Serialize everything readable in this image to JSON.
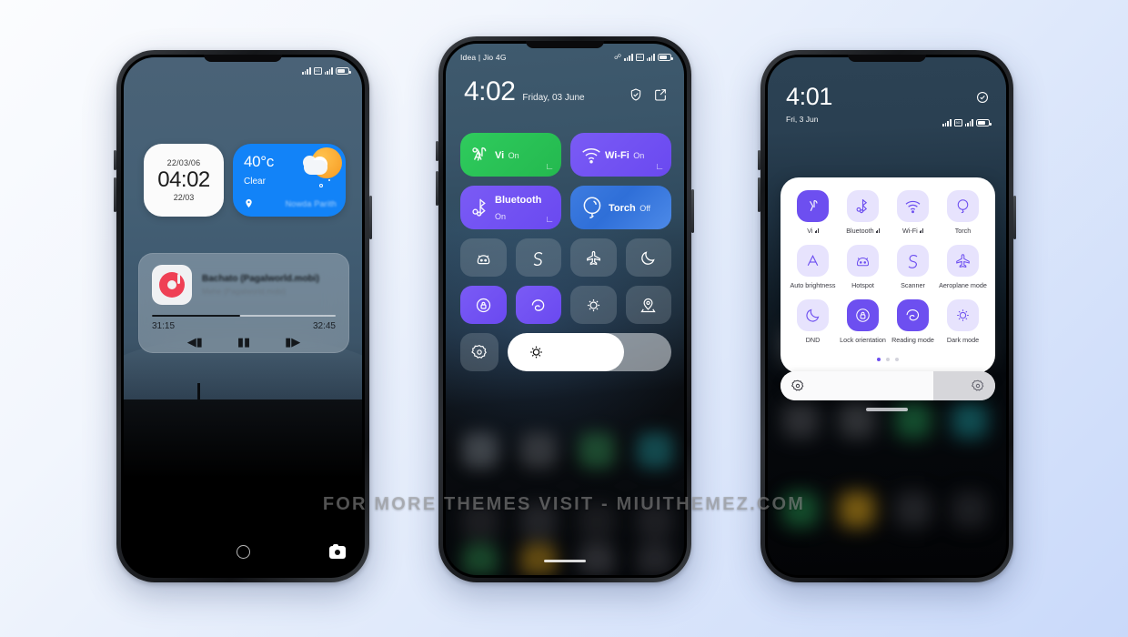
{
  "watermark": "FOR MORE THEMES VISIT - MIUITHEMEZ.COM",
  "colors": {
    "accent_purple": "#6d4ff0",
    "accent_purple_light": "#e7e3fd",
    "tile_green": "#2fcb5d",
    "tile_blue": "#3e7ce0",
    "weather_blue": "#1283f8",
    "page_bg_start": "#fbfcfe",
    "page_bg_end": "#c9d9fa"
  },
  "lockscreen": {
    "statusbar": {
      "carrier": "",
      "icons": [
        "signal-bars-icon",
        "sim-card-icon",
        "signal-bars-icon",
        "battery-icon"
      ]
    },
    "clock_widget": {
      "date_top": "22/03/06",
      "time": "04:02",
      "date_bottom": "22/03"
    },
    "weather_widget": {
      "temperature": "40°c",
      "condition": "Clear",
      "location": "Nowda Parith",
      "icon": "partly-cloudy-icon"
    },
    "music_player": {
      "title": "Bachato (Pagalworld.mobi)",
      "artist": "Mehe (Pagalworld.mobi)",
      "elapsed": "31:15",
      "duration": "32:45",
      "progress_percent": 48,
      "controls": [
        "previous-track",
        "pause",
        "next-track"
      ]
    },
    "bottom": {
      "fingerprint": "fingerprint-icon",
      "camera": "camera-icon"
    }
  },
  "control_center_dark": {
    "statusbar": {
      "carrier": "Idea | Jio 4G",
      "icons": [
        "bluetooth-icon",
        "signal-bars-icon",
        "sim-card-icon",
        "signal-bars-icon",
        "battery-icon"
      ]
    },
    "header": {
      "time": "4:02",
      "date": "Friday, 03 June",
      "actions": [
        "shield-check-icon",
        "edit-square-icon"
      ]
    },
    "big_tiles": [
      {
        "name": "Vi",
        "state": "On",
        "icon": "cell-tower-icon",
        "active": true,
        "style": "green"
      },
      {
        "name": "Wi-Fi",
        "state": "On",
        "icon": "wifi-icon",
        "active": true,
        "style": "purple"
      },
      {
        "name": "Bluetooth",
        "state": "On",
        "icon": "bluetooth-earbuds-icon",
        "active": true,
        "style": "purple"
      },
      {
        "name": "Torch",
        "state": "Off",
        "icon": "bulb-icon",
        "active": false,
        "style": "blue"
      }
    ],
    "small_tiles_row1": [
      {
        "icon": "hotspot-icon",
        "active": false
      },
      {
        "icon": "scanner-icon",
        "active": false
      },
      {
        "icon": "aeroplane-mode-icon",
        "active": false
      },
      {
        "icon": "dnd-moon-icon",
        "active": false
      }
    ],
    "small_tiles_row2": [
      {
        "icon": "lock-orientation-icon",
        "active": true
      },
      {
        "icon": "reading-mode-icon",
        "active": true
      },
      {
        "icon": "dark-mode-icon",
        "active": false
      },
      {
        "icon": "location-icon",
        "active": false
      }
    ],
    "brightness": {
      "gear_icon": "brightness-settings-icon",
      "slider_icon": "sun-icon",
      "level_percent": 71
    }
  },
  "control_center_light": {
    "header": {
      "time": "4:01",
      "date": "Fri, 3 Jun",
      "edit_icon": "shield-check-icon",
      "icons": [
        "signal-bars-icon",
        "sim-card-icon",
        "signal-bars-icon",
        "battery-icon"
      ]
    },
    "tiles": [
      {
        "label": "Vi",
        "icon": "cell-tower-icon",
        "active": true,
        "signal": true
      },
      {
        "label": "Bluetooth",
        "icon": "bluetooth-earbuds-icon",
        "active": false,
        "signal": true
      },
      {
        "label": "Wi-Fi",
        "icon": "wifi-icon",
        "active": false,
        "signal": true
      },
      {
        "label": "Torch",
        "icon": "bulb-icon",
        "active": false,
        "signal": false
      },
      {
        "label": "Auto brightness",
        "icon": "auto-brightness-icon",
        "active": false,
        "signal": false
      },
      {
        "label": "Hotspot",
        "icon": "hotspot-icon",
        "active": false,
        "signal": false
      },
      {
        "label": "Scanner",
        "icon": "scanner-icon",
        "active": false,
        "signal": false
      },
      {
        "label": "Aeroplane mode",
        "icon": "aeroplane-mode-icon",
        "active": false,
        "signal": false
      },
      {
        "label": "DND",
        "icon": "dnd-moon-icon",
        "active": false,
        "signal": false
      },
      {
        "label": "Lock orientation",
        "icon": "lock-orientation-icon",
        "active": true,
        "signal": false
      },
      {
        "label": "Reading mode",
        "icon": "reading-mode-icon",
        "active": true,
        "signal": false
      },
      {
        "label": "Dark mode",
        "icon": "dark-mode-icon",
        "active": false,
        "signal": false
      }
    ],
    "page_dots": {
      "count": 3,
      "active_index": 0
    },
    "brightness": {
      "left_icon": "brightness-settings-icon",
      "right_icon": "brightness-settings-icon",
      "level_percent": 71
    }
  }
}
